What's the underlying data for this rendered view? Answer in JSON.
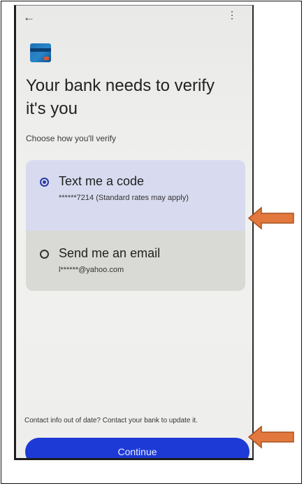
{
  "header": {
    "back_icon": "←",
    "more_icon": "⋮"
  },
  "title": "Your bank needs to verify it's you",
  "subtitle": "Choose how you'll verify",
  "options": [
    {
      "title": "Text me a code",
      "detail": "******7214 (Standard rates may apply)",
      "selected": true
    },
    {
      "title": "Send me an email",
      "detail": "l******@yahoo.com",
      "selected": false
    }
  ],
  "contact_note": "Contact info out of date? Contact your bank to update it.",
  "continue_label": "Continue",
  "colors": {
    "primary": "#1d3ad6",
    "selected_option_bg": "#d8dbef",
    "option_bg": "#d9d9d6",
    "callout_arrow": "#e2783d"
  }
}
